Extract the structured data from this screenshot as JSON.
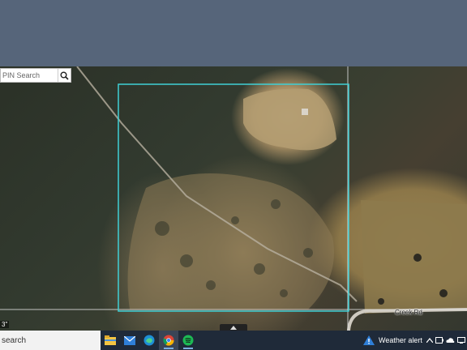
{
  "search": {
    "placeholder": "PIN Search"
  },
  "map": {
    "road_label": "Creek Rd",
    "scale_text": "3\"",
    "parcel_color": "#3fd0d6"
  },
  "taskbar": {
    "search_text": "search",
    "weather": "Weather alert",
    "apps": [
      "file-explorer",
      "mail",
      "edge",
      "chrome",
      "spotify"
    ]
  }
}
